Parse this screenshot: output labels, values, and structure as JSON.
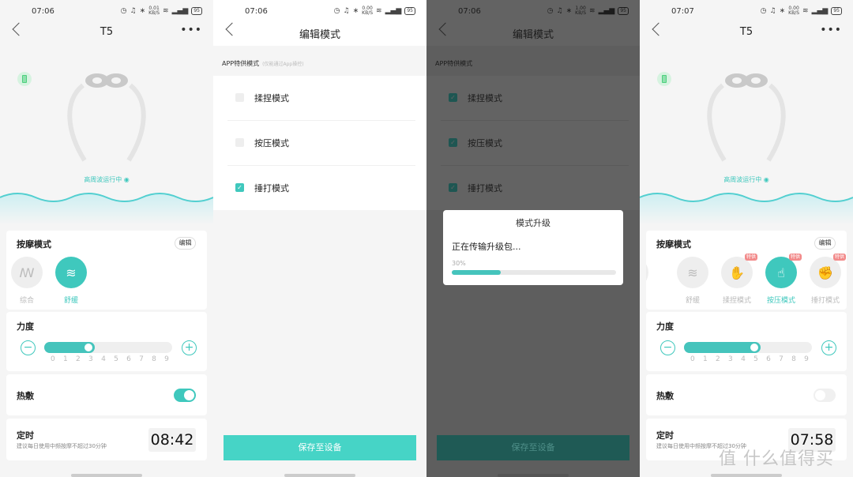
{
  "colors": {
    "accent": "#3fc8bd",
    "button": "#46d4c6",
    "badge": "#f28a8a",
    "battery": "#4cd07d"
  },
  "screens": [
    {
      "status": {
        "time": "07:06",
        "speed": "0.01",
        "speed_unit": "KB/S",
        "battery": "95"
      },
      "nav": {
        "title": "T5",
        "more": "•••"
      },
      "device_status": "高周波运行中",
      "massage": {
        "title": "按摩模式",
        "edit": "编辑",
        "modes": [
          {
            "label": "综合",
            "icon": "hands-icon",
            "selected": false
          },
          {
            "label": "舒缓",
            "icon": "waves-icon",
            "selected": true
          }
        ]
      },
      "intensity": {
        "title": "力度",
        "value": 3,
        "ticks": [
          "0",
          "1",
          "2",
          "3",
          "4",
          "5",
          "6",
          "7",
          "8",
          "9"
        ]
      },
      "heat": {
        "title": "热敷",
        "on": true
      },
      "timer": {
        "title": "定时",
        "hint": "建议每日使用中频按摩不超过30分钟",
        "remaining": "08:42"
      }
    },
    {
      "status": {
        "time": "07:06",
        "speed": "0.00",
        "speed_unit": "KB/S",
        "battery": "95"
      },
      "nav": {
        "title": "编辑模式"
      },
      "section": {
        "title": "APP特供模式",
        "note": "(仅能通过App操控)"
      },
      "modes": [
        {
          "label": "揉捏模式",
          "checked": false
        },
        {
          "label": "按压模式",
          "checked": false
        },
        {
          "label": "捶打模式",
          "checked": true
        }
      ],
      "save": "保存至设备"
    },
    {
      "status": {
        "time": "07:06",
        "speed": "1.00",
        "speed_unit": "KB/S",
        "battery": "95"
      },
      "nav": {
        "title": "编辑模式"
      },
      "section": {
        "title": "APP特供模式"
      },
      "modes": [
        {
          "label": "揉捏模式",
          "checked": true
        },
        {
          "label": "按压模式",
          "checked": true
        },
        {
          "label": "捶打模式",
          "checked": true
        }
      ],
      "save": "保存至设备",
      "dialog": {
        "title": "模式升级",
        "message": "正在传输升级包...",
        "progress_label": "30%",
        "progress": 30
      }
    },
    {
      "status": {
        "time": "07:07",
        "speed": "0.00",
        "speed_unit": "KB/S",
        "battery": "95"
      },
      "nav": {
        "title": "T5",
        "more": "•••"
      },
      "device_status": "高周波运行中",
      "massage": {
        "title": "按摩模式",
        "edit": "编辑",
        "modes": [
          {
            "label": "舒缓",
            "icon": "waves-icon",
            "selected": false
          },
          {
            "label": "揉捏模式",
            "icon": "kneading-hand-icon",
            "badge": "特供",
            "selected": false
          },
          {
            "label": "按压模式",
            "icon": "pointing-hand-icon",
            "badge": "特供",
            "selected": true
          },
          {
            "label": "捶打模式",
            "icon": "fist-icon",
            "badge": "特供",
            "selected": false
          }
        ]
      },
      "intensity": {
        "title": "力度",
        "value": 5,
        "ticks": [
          "0",
          "1",
          "2",
          "3",
          "4",
          "5",
          "6",
          "7",
          "8",
          "9"
        ]
      },
      "heat": {
        "title": "热敷",
        "on": false
      },
      "timer": {
        "title": "定时",
        "hint": "建议每日使用中频按摩不超过30分钟",
        "remaining": "07:58"
      }
    }
  ],
  "watermark": "值 什么值得买"
}
